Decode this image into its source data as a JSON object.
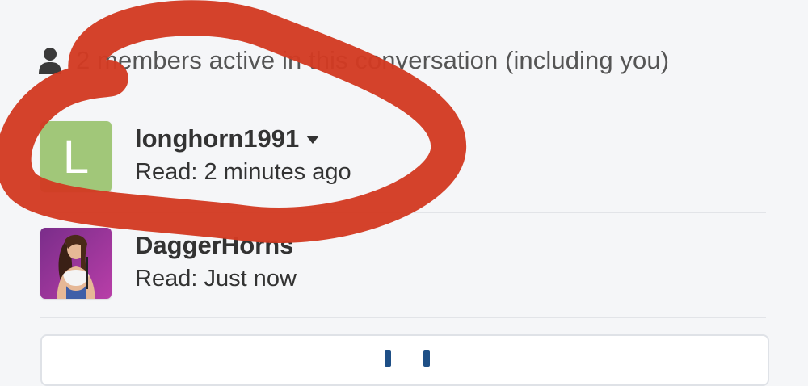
{
  "header": {
    "icon": "person-icon",
    "text": "2 members active in this conversation (including you)"
  },
  "members": [
    {
      "name": "longhorn1991",
      "avatar_letter": "L",
      "avatar_color": "#a1c779",
      "has_menu": true,
      "read_status": "Read: 2 minutes ago"
    },
    {
      "name": "DaggerHorns",
      "avatar_type": "photo",
      "read_status": "Read: Just now"
    }
  ],
  "colors": {
    "background": "#f5f6f8",
    "annotation_red": "#d23a22",
    "link_blue": "#1e4f86"
  }
}
